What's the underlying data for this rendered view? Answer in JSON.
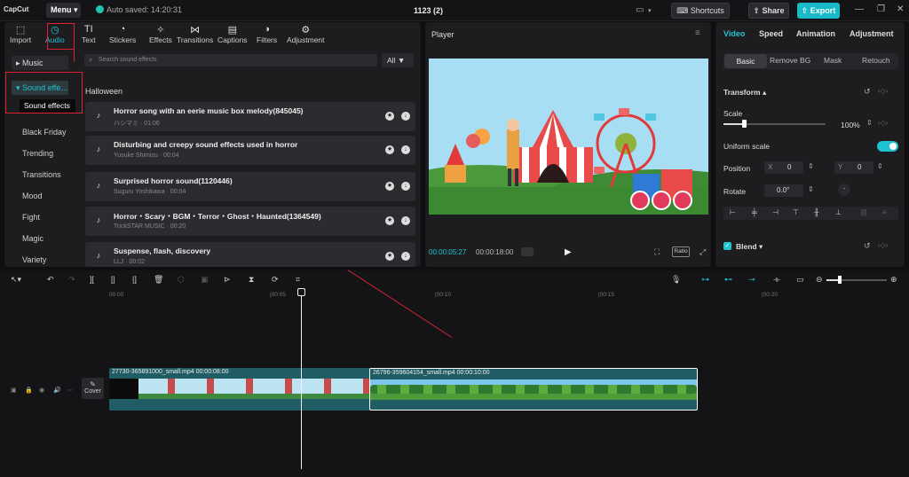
{
  "app": {
    "logo": "CapCut",
    "menu": "Menu",
    "autosave": "Auto saved: 14:20:31",
    "project": "1123 (2)",
    "shortcuts": "Shortcuts",
    "share": "Share",
    "export": "Export"
  },
  "toolbar": [
    "Import",
    "Audio",
    "Text",
    "Stickers",
    "Effects",
    "Transitions",
    "Captions",
    "Filters",
    "Adjustment"
  ],
  "sidebar": {
    "music": "Music",
    "sound_effects": "Sound effe...",
    "tooltip": "Sound effects",
    "items": [
      "Black Friday",
      "Trending",
      "Transitions",
      "Mood",
      "Fight",
      "Magic",
      "Variety"
    ]
  },
  "search": {
    "placeholder": "Search sound effects",
    "all": "All"
  },
  "section": "Halloween",
  "tracks": [
    {
      "title": "Horror song with an eerie music box melody(845045)",
      "sub": "ハシマミ · 01:06"
    },
    {
      "title": "Disturbing and creepy sound effects used in horror",
      "sub": "Yusuke Shimizu · 00:04"
    },
    {
      "title": "Surprised horror sound(1120446)",
      "sub": "Suguru Yoshikawa · 00:04"
    },
    {
      "title": "Horror・Scary・BGM・Terror・Ghost・Haunted(1364549)",
      "sub": "TrickSTAR MUSIC · 00:20"
    },
    {
      "title": "Suspense, flash, discovery",
      "sub": "LLJ · 00:02"
    }
  ],
  "player": {
    "title": "Player",
    "current": "00:00:05:27",
    "total": "00:00:18:00",
    "ratio": "Ratio"
  },
  "right": {
    "tabs": [
      "Video",
      "Speed",
      "Animation",
      "Adjustment"
    ],
    "subtabs": [
      "Basic",
      "Remove BG",
      "Mask",
      "Retouch"
    ],
    "transform": "Transform",
    "scale": "Scale",
    "scale_value": "100%",
    "uniform": "Uniform scale",
    "position": "Position",
    "x_label": "X",
    "x_value": "0",
    "y_label": "Y",
    "y_value": "0",
    "rotate": "Rotate",
    "rotate_value": "0.0°",
    "blend": "Blend"
  },
  "timeline": {
    "ruler": [
      "00:00",
      "|00:05",
      "|00:10",
      "|00:15",
      "|00:20"
    ],
    "cover": "Cover",
    "clip1": "27730-365891000_small.mp4   00:00:08:00",
    "clip2": "26796-359604154_small.mp4   00:00:10:00"
  },
  "colors": {
    "accent": "#20c3d0",
    "export": "#18b9c8",
    "highlight": "#dd2233"
  }
}
